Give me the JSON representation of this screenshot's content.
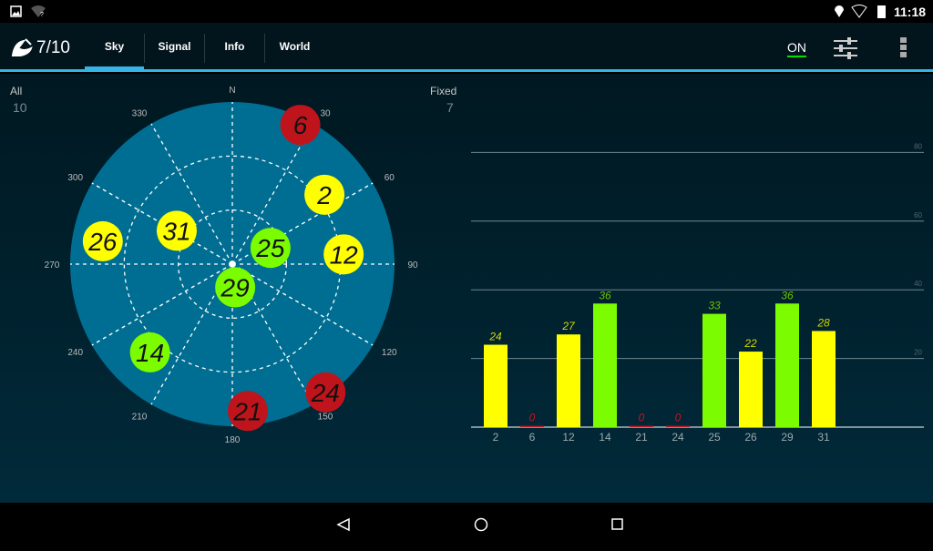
{
  "status": {
    "time": "11:18",
    "icons": [
      "image-icon",
      "wifi-unknown-icon",
      "location-icon",
      "wifi-icon",
      "battery-icon"
    ]
  },
  "appbar": {
    "count": "7/10",
    "tabs": [
      {
        "label": "Sky",
        "active": true
      },
      {
        "label": "Signal"
      },
      {
        "label": "Info"
      },
      {
        "label": "World"
      }
    ],
    "on_label": "ON",
    "accent": "#33b5e5"
  },
  "sky": {
    "all_label": "All",
    "all_value": "10",
    "fixed_label": "Fixed",
    "fixed_value": "7",
    "north": "N",
    "azimuth_labels": [
      "30",
      "60",
      "90",
      "120",
      "150",
      "180",
      "210",
      "240",
      "270",
      "300",
      "330"
    ],
    "satellites": [
      {
        "prn": "6",
        "az": 26,
        "el": 4,
        "status": "red"
      },
      {
        "prn": "2",
        "az": 53,
        "el": 26,
        "status": "yellow"
      },
      {
        "prn": "12",
        "az": 85,
        "el": 28,
        "status": "yellow"
      },
      {
        "prn": "25",
        "az": 67,
        "el": 67,
        "status": "green"
      },
      {
        "prn": "29",
        "az": 173,
        "el": 77,
        "status": "green"
      },
      {
        "prn": "31",
        "az": 301,
        "el": 54,
        "status": "yellow"
      },
      {
        "prn": "26",
        "az": 280,
        "el": 17,
        "status": "yellow"
      },
      {
        "prn": "14",
        "az": 223,
        "el": 23,
        "status": "green"
      },
      {
        "prn": "21",
        "az": 174,
        "el": 8,
        "status": "red"
      },
      {
        "prn": "24",
        "az": 144,
        "el": 2,
        "status": "red"
      }
    ]
  },
  "colors": {
    "red": "#c0141c",
    "yellow": "#ffff00",
    "green": "#7cfc00",
    "plot": "#006e92"
  },
  "chart_data": {
    "type": "bar",
    "categories": [
      "2",
      "6",
      "12",
      "14",
      "21",
      "24",
      "25",
      "26",
      "29",
      "31"
    ],
    "values": [
      24,
      0,
      27,
      36,
      0,
      0,
      33,
      22,
      36,
      28
    ],
    "status": [
      "yellow",
      "red",
      "yellow",
      "green",
      "red",
      "red",
      "green",
      "yellow",
      "green",
      "yellow"
    ],
    "yticks": [
      20,
      40,
      60,
      80
    ],
    "ylim": [
      0,
      80
    ],
    "grid": true
  }
}
